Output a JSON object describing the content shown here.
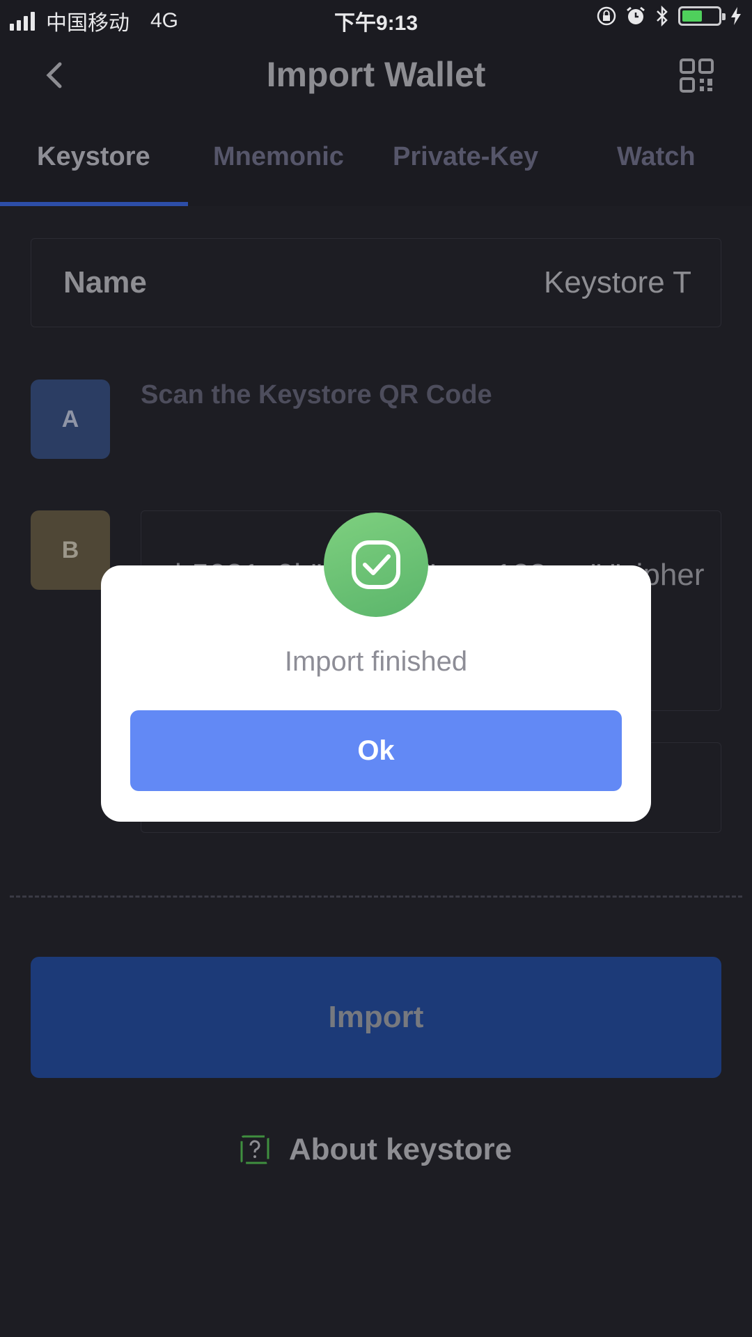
{
  "status_bar": {
    "carrier": "中国移动",
    "network": "4G",
    "time": "下午9:13",
    "battery_level": 0.5
  },
  "header": {
    "title": "Import Wallet",
    "back_icon": "chevron-left-icon",
    "scan_icon": "qr-code-icon"
  },
  "tabs": [
    {
      "label": "Keystore",
      "active": true
    },
    {
      "label": "Mnemonic",
      "active": false
    },
    {
      "label": "Private-Key",
      "active": false
    },
    {
      "label": "Watch",
      "active": false
    }
  ],
  "form": {
    "name_label": "Name",
    "name_value": "Keystore T",
    "step_a_badge": "A",
    "step_a_text": "Scan the Keystore QR Code",
    "step_b_badge": "B",
    "keystore_text": "b5021a9b\"cipher\":\"aes-128-ctr\",\"cipherparams\":{\"iv\":\"2a8d2f1q"
  },
  "import_button": "Import",
  "about": {
    "label": "About keystore",
    "icon": "question-icon"
  },
  "modal": {
    "icon": "check-circle-icon",
    "message": "Import finished",
    "ok_label": "Ok"
  },
  "colors": {
    "background": "#1b1b21",
    "primary": "#6289f5",
    "import_button": "#1c3a78",
    "success": "#5bb56b"
  }
}
